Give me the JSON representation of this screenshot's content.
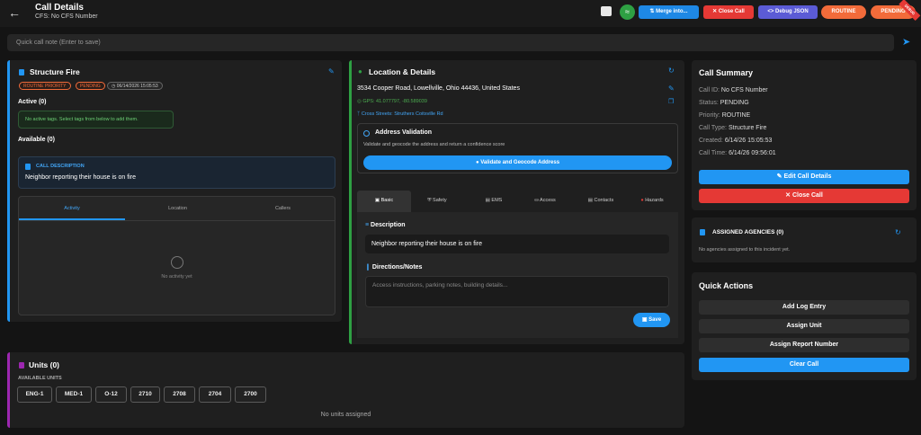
{
  "header": {
    "title": "Call Details",
    "subtitle": "CFS: No CFS Number",
    "buttons": {
      "merge": "Merge into...",
      "close_call": "Close Call",
      "debug": "Debug JSON",
      "routine": "ROUTINE",
      "pending": "PENDING"
    },
    "ribbon": "DEBUG"
  },
  "quick_note": {
    "placeholder": "Quick call note (Enter to save)"
  },
  "incident": {
    "type": "Structure Fire",
    "priority_badge": "ROUTINE PRIORITY",
    "status_badge": "PENDING",
    "time_badge": "06/14/2026 15:05:53",
    "active_label": "Active (0)",
    "active_empty": "No active tags. Select tags from below to add them.",
    "available_label": "Available (0)",
    "description_heading": "CALL DESCRIPTION",
    "description": "Neighbor reporting their house is on fire",
    "tabs": [
      "Activity",
      "Location",
      "Callers"
    ],
    "activity_empty": "No activity yet"
  },
  "location": {
    "heading": "Location & Details",
    "address": "3534 Cooper Road, Lowellville, Ohio 44436, United States",
    "gps": "GPS: 41.077797, -80.589039",
    "cross_streets": "Cross Streets: Struthers Coitsville Rd",
    "validation_title": "Address Validation",
    "validation_desc": "Validate and geocode the address and return a confidence score",
    "validate_button": "Validate and Geocode Address",
    "tabs": [
      "Basic",
      "Safety",
      "EMS",
      "Access",
      "Contacts",
      "Hazards"
    ],
    "description_label": "Description",
    "description_value": "Neighbor reporting their house is on fire",
    "directions_label": "Directions/Notes",
    "directions_placeholder": "Access instructions, parking notes, building details...",
    "save_button": "Save"
  },
  "units": {
    "heading": "Units (0)",
    "available_label": "AVAILABLE UNITS",
    "available": [
      "ENG-1",
      "MED-1",
      "O-12",
      "2710",
      "2708",
      "2704",
      "2700"
    ],
    "empty": "No units assigned"
  },
  "summary": {
    "heading": "Call Summary",
    "rows": [
      {
        "label": "Call ID:",
        "value": "No CFS Number"
      },
      {
        "label": "Status:",
        "value": "PENDING"
      },
      {
        "label": "Priority:",
        "value": "ROUTINE"
      },
      {
        "label": "Call Type:",
        "value": "Structure Fire"
      },
      {
        "label": "Created:",
        "value": "6/14/26 15:05:53"
      },
      {
        "label": "Call Time:",
        "value": "6/14/26 09:56:01"
      }
    ],
    "edit_button": "Edit Call Details",
    "close_button": "Close Call"
  },
  "agencies": {
    "heading": "ASSIGNED AGENCIES (0)",
    "empty": "No agencies assigned to this incident yet."
  },
  "quick_actions": {
    "heading": "Quick Actions",
    "buttons": [
      "Add Log Entry",
      "Assign Unit",
      "Assign Report Number",
      "Clear Call"
    ]
  },
  "colors": {
    "accent_blue": "#2196f3",
    "danger_red": "#e53935",
    "success_green": "#2ea043",
    "purple": "#5b5bd6",
    "orange": "#f26b3a",
    "units_magenta": "#9c27b0"
  }
}
